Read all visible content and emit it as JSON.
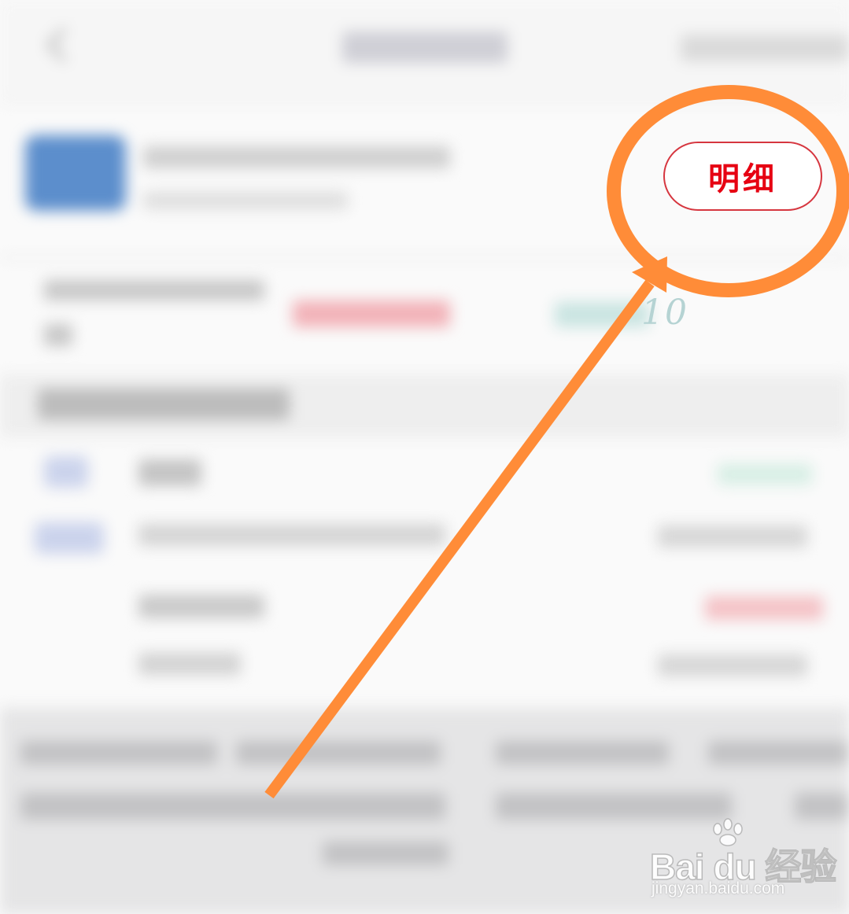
{
  "detail": {
    "label": "明细"
  },
  "summary": {
    "number_fragment": "10"
  },
  "watermark": {
    "logo_text": "Bai du 经验",
    "url": "jingyan.baidu.com",
    "icon": "paw-icon"
  },
  "annotation": {
    "color": "#ff8c38",
    "shapes": [
      "circle-highlight",
      "arrow"
    ]
  },
  "colors": {
    "accent_red": "#e60012",
    "annotation_orange": "#ff8c38"
  }
}
